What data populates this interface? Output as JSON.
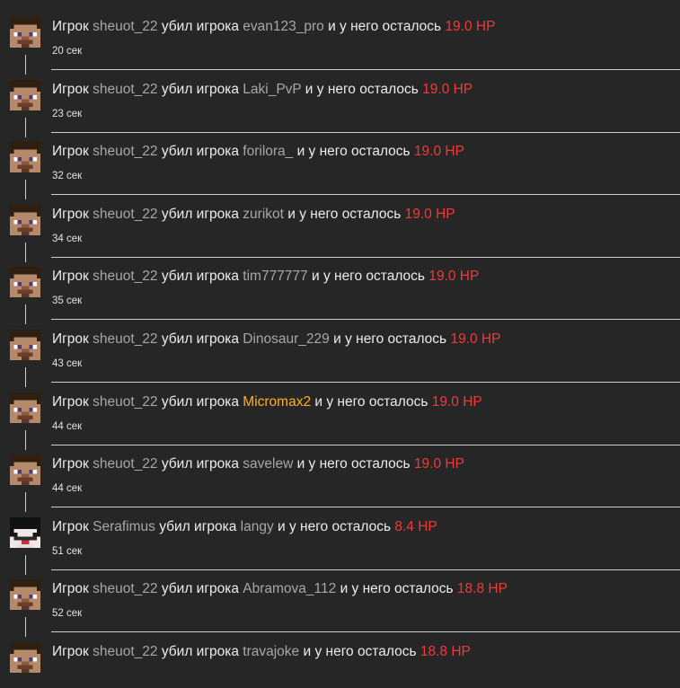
{
  "labels": {
    "prefix": "Игрок",
    "killed": "убил игрока",
    "remaining": "и у него осталось"
  },
  "colors": {
    "background": "#262626",
    "player_name": "#a7a7a7",
    "highlight_player": "#ffb01f",
    "hp": "#f03a3a",
    "text": "#ececec"
  },
  "entries": [
    {
      "killer": "sheuot_22",
      "victim": "evan123_pro",
      "hp": "19.0 HP",
      "time": "20 сек",
      "avatar": "steve-head-icon"
    },
    {
      "killer": "sheuot_22",
      "victim": "Laki_PvP",
      "hp": "19.0 HP",
      "time": "23 сек",
      "avatar": "steve-head-icon"
    },
    {
      "killer": "sheuot_22",
      "victim": "forilora_",
      "hp": "19.0 HP",
      "time": "32 сек",
      "avatar": "steve-head-icon"
    },
    {
      "killer": "sheuot_22",
      "victim": "zurikot",
      "hp": "19.0 HP",
      "time": "34 сек",
      "avatar": "steve-head-icon"
    },
    {
      "killer": "sheuot_22",
      "victim": "tim777777",
      "hp": "19.0 HP",
      "time": "35 сек",
      "avatar": "steve-head-icon"
    },
    {
      "killer": "sheuot_22",
      "victim": "Dinosaur_229",
      "hp": "19.0 HP",
      "time": "43 сек",
      "avatar": "steve-head-icon"
    },
    {
      "killer": "sheuot_22",
      "victim": "Micromax2",
      "victim_highlight": true,
      "hp": "19.0 HP",
      "time": "44 сек",
      "avatar": "steve-head-icon"
    },
    {
      "killer": "sheuot_22",
      "victim": "savelew",
      "hp": "19.0 HP",
      "time": "44 сек",
      "avatar": "steve-head-icon"
    },
    {
      "killer": "Serafimus",
      "victim": "langy",
      "hp": "8.4 HP",
      "time": "51 сек",
      "avatar": "masked-head-icon"
    },
    {
      "killer": "sheuot_22",
      "victim": "Abramova_112",
      "hp": "18.8 HP",
      "time": "52 сек",
      "avatar": "steve-head-icon"
    },
    {
      "killer": "sheuot_22",
      "victim": "travajoke",
      "hp": "18.8 HP",
      "time": "",
      "avatar": "steve-head-icon"
    }
  ]
}
